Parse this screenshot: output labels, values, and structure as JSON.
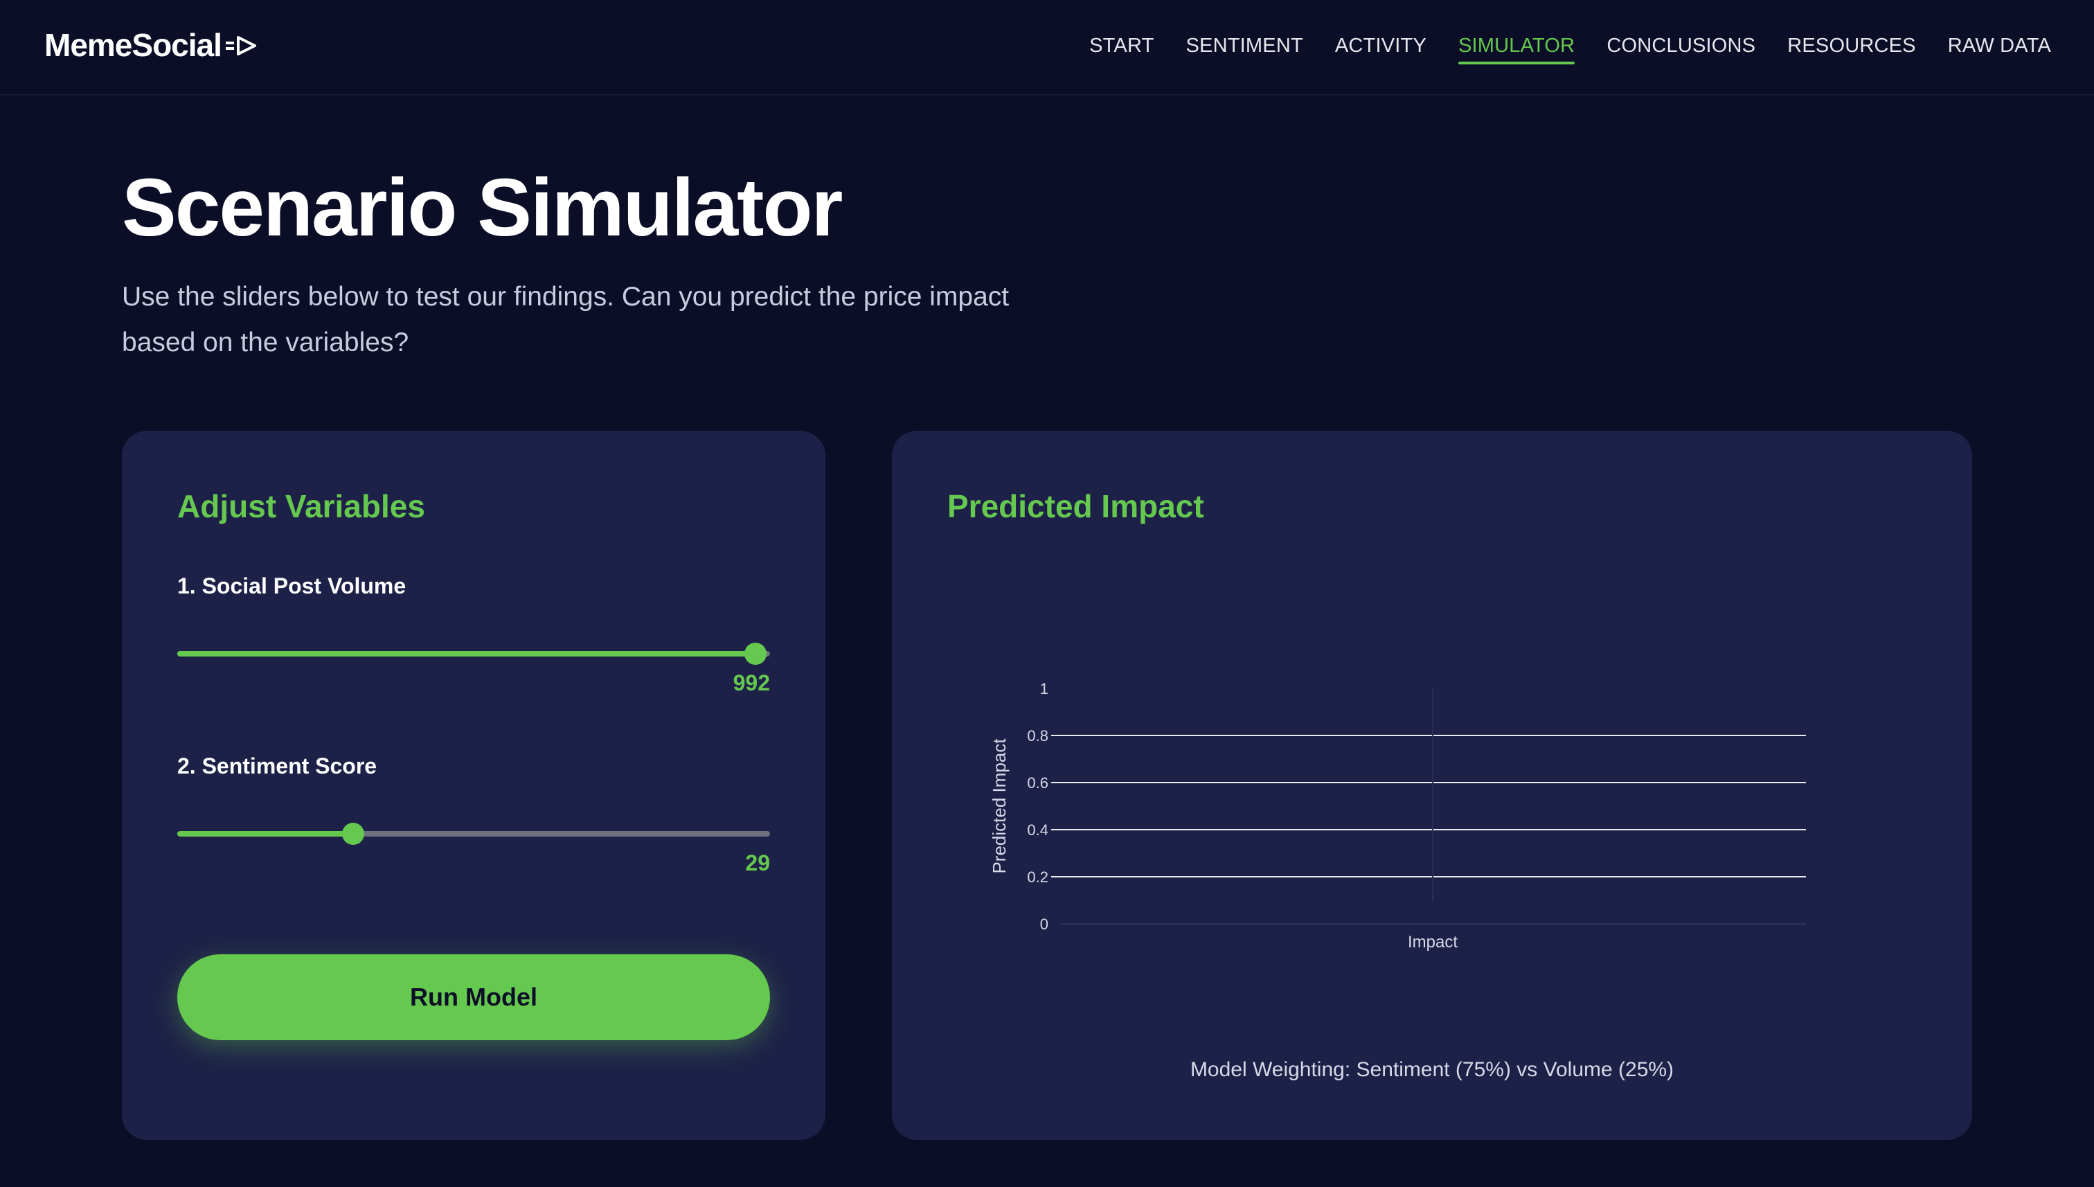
{
  "brand": {
    "name": "MemeSocial",
    "logo_icon": "arrow-right-icon"
  },
  "nav": {
    "items": [
      {
        "label": "START",
        "active": false
      },
      {
        "label": "SENTIMENT",
        "active": false
      },
      {
        "label": "ACTIVITY",
        "active": false
      },
      {
        "label": "SIMULATOR",
        "active": true
      },
      {
        "label": "CONCLUSIONS",
        "active": false
      },
      {
        "label": "RESOURCES",
        "active": false
      },
      {
        "label": "RAW DATA",
        "active": false
      }
    ]
  },
  "page": {
    "title": "Scenario Simulator",
    "subtitle": "Use the sliders below to test our findings. Can you predict the price impact based on the variables?"
  },
  "controls": {
    "title": "Adjust Variables",
    "volume": {
      "label": "1. Social Post Volume",
      "value": "992",
      "fraction": 0.976
    },
    "sentiment": {
      "label": "2. Sentiment Score",
      "value": "29",
      "fraction": 0.297
    },
    "run_label": "Run Model"
  },
  "impact": {
    "title": "Predicted Impact",
    "footnote": "Model Weighting: Sentiment (75%) vs Volume (25%)"
  },
  "colors": {
    "accent": "#66c94f",
    "background": "#0b0e26",
    "card": "#1d2147"
  },
  "chart_data": {
    "type": "bar",
    "categories": [
      "Impact"
    ],
    "values": [
      0
    ],
    "ylabel": "Predicted Impact",
    "ylim": [
      0,
      1
    ],
    "yticks": [
      0,
      0.2,
      0.4,
      0.6,
      0.8,
      1
    ],
    "ytick_labels": [
      "0",
      "0.2",
      "0.4",
      "0.6",
      "0.8",
      "1"
    ],
    "grid": true
  }
}
